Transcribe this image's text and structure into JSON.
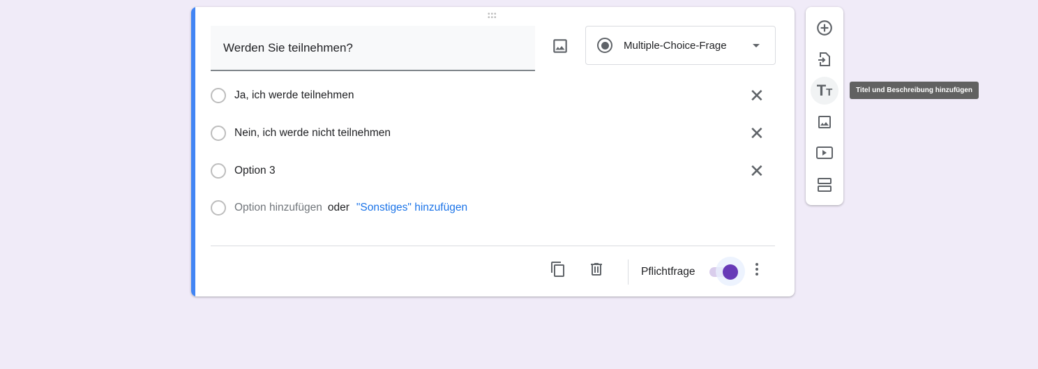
{
  "question": {
    "title": "Werden Sie teilnehmen?",
    "type": "Multiple-Choice-Frage"
  },
  "options": [
    {
      "label": "Ja, ich werde teilnehmen"
    },
    {
      "label": "Nein, ich werde nicht teilnehmen"
    },
    {
      "label": "Option 3"
    }
  ],
  "add_option": {
    "label": "Option hinzufügen",
    "or": "oder",
    "other": "\"Sonstiges\" hinzufügen"
  },
  "footer": {
    "required_label": "Pflichtfrage",
    "required": true
  },
  "sidebar": {
    "tooltip": "Titel und Beschreibung hinzufügen"
  },
  "colors": {
    "accent": "#673ab7",
    "strip": "#4285f4",
    "background": "#f0ebf8"
  }
}
